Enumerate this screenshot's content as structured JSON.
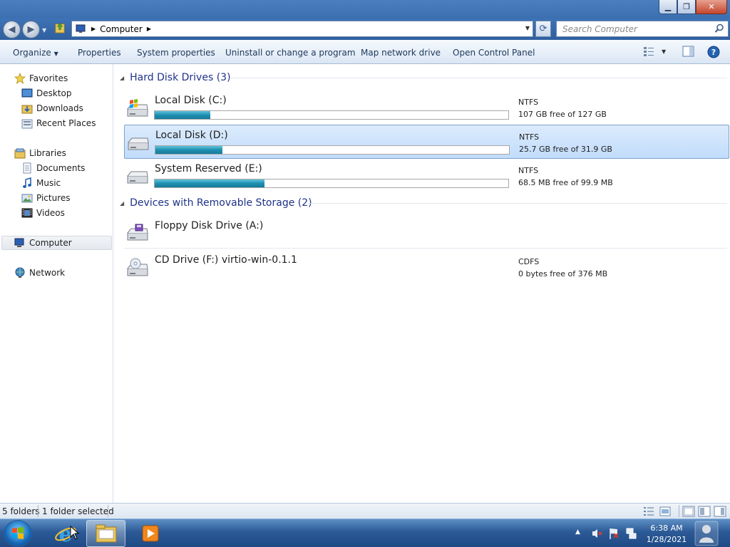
{
  "window": {
    "caption_buttons": [
      "minimize-icon",
      "maximize-icon",
      "close-icon"
    ]
  },
  "address_bar": {
    "breadcrumb": "Computer",
    "search_placeholder": "Search Computer"
  },
  "command_bar": {
    "organize": "Organize",
    "properties": "Properties",
    "system_properties": "System properties",
    "uninstall": "Uninstall or change a program",
    "map_drive": "Map network drive",
    "control_panel": "Open Control Panel"
  },
  "nav_pane": {
    "favorites": "Favorites",
    "desktop": "Desktop",
    "downloads": "Downloads",
    "recent_places": "Recent Places",
    "libraries": "Libraries",
    "documents": "Documents",
    "music": "Music",
    "pictures": "Pictures",
    "videos": "Videos",
    "computer": "Computer",
    "network": "Network"
  },
  "groups": {
    "hard_disk": "Hard Disk Drives (3)",
    "removable": "Devices with Removable Storage (2)"
  },
  "drives": [
    {
      "name": "Local Disk (C:)",
      "fs": "NTFS",
      "free": "107 GB free of 127 GB",
      "used_fraction": 0.157,
      "icon": "windows-disk-icon",
      "selected": false
    },
    {
      "name": "Local Disk (D:)",
      "fs": "NTFS",
      "free": "25.7 GB free of 31.9 GB",
      "used_fraction": 0.19,
      "icon": "hard-disk-icon",
      "selected": true
    },
    {
      "name": "System Reserved (E:)",
      "fs": "NTFS",
      "free": "68.5 MB free of 99.9 MB",
      "used_fraction": 0.31,
      "icon": "hard-disk-icon",
      "selected": false
    }
  ],
  "removable": [
    {
      "name": "Floppy Disk Drive (A:)",
      "fs": "",
      "free": "",
      "icon": "floppy-drive-icon"
    },
    {
      "name": "CD Drive (F:) virtio-win-0.1.1",
      "fs": "CDFS",
      "free": "0 bytes free of 376 MB",
      "icon": "cd-drive-icon"
    }
  ],
  "status_bar": {
    "count": "5 folders",
    "selection": "1 folder selected"
  },
  "taskbar": {
    "time": "6:38 AM",
    "date": "1/28/2021"
  }
}
